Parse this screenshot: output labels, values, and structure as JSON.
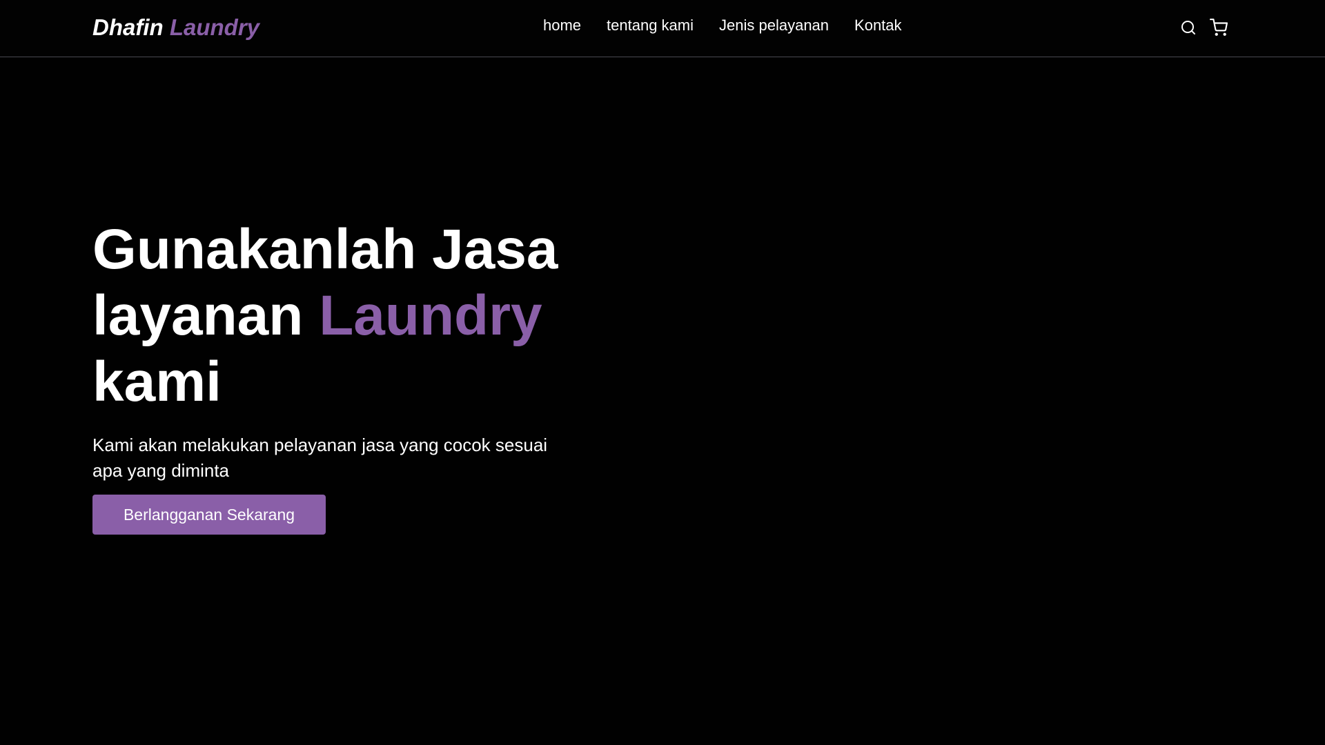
{
  "navbar": {
    "logo": {
      "part1": "Dhafin",
      "part2": "Laundry"
    },
    "links": [
      {
        "label": "home"
      },
      {
        "label": "tentang kami"
      },
      {
        "label": "Jenis pelayanan"
      },
      {
        "label": "Kontak"
      }
    ],
    "icons": [
      "search-icon",
      "shopping-cart-icon"
    ]
  },
  "hero": {
    "title_line1": "Gunakanlah Jasa",
    "title_line2_prefix": "layanan",
    "title_accent": "Laundry",
    "title_line3": "kami",
    "subtitle": "Kami akan melakukan pelayanan jasa yang cocok sesuai apa yang diminta",
    "cta_label": "Berlangganan Sekarang"
  },
  "colors": {
    "background": "#010101",
    "accent": "#8a5fa8",
    "text": "#ffffff",
    "divider": "#4a4a52"
  }
}
